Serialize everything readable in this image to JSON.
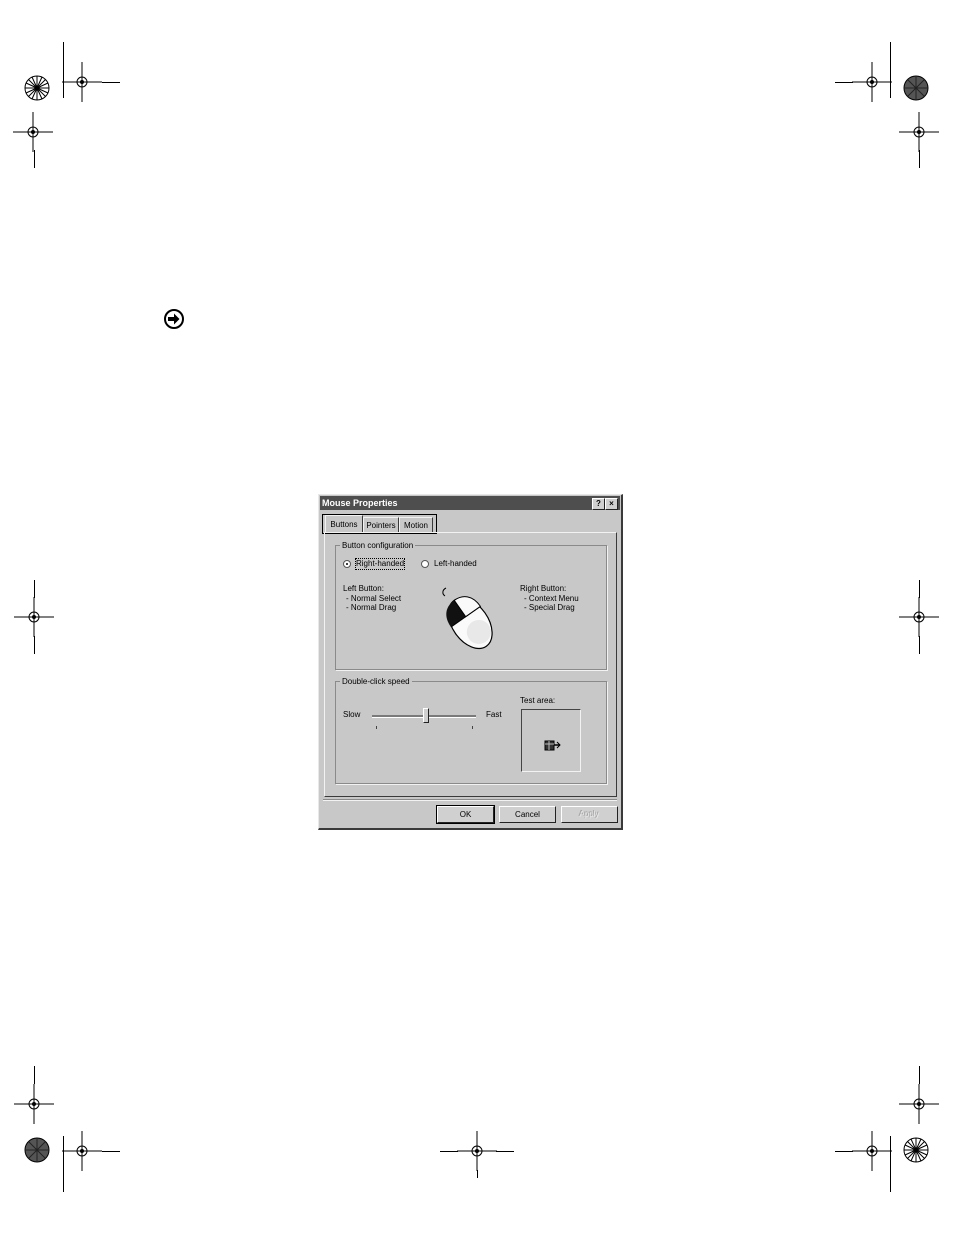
{
  "dialog": {
    "title": "Mouse Properties",
    "help_glyph": "?",
    "close_glyph": "×",
    "tabs": [
      {
        "label": "Buttons",
        "selected": true
      },
      {
        "label": "Pointers",
        "selected": false
      },
      {
        "label": "Motion",
        "selected": false
      }
    ],
    "button_config": {
      "group_label": "Button configuration",
      "right_handed_label": "Right-handed",
      "left_handed_label": "Left-handed",
      "selected": "Right-handed",
      "left_button_heading": "Left Button:",
      "left_button_lines": [
        "- Normal Select",
        "- Normal Drag"
      ],
      "right_button_heading": "Right Button:",
      "right_button_lines": [
        "- Context Menu",
        "- Special Drag"
      ]
    },
    "double_click": {
      "group_label": "Double-click speed",
      "slow_label": "Slow",
      "fast_label": "Fast",
      "test_area_label": "Test area:",
      "speed_level": 0.5
    },
    "buttons": {
      "ok": "OK",
      "cancel": "Cancel",
      "apply": "Apply"
    }
  },
  "icons": {
    "registration_mark": "crosshair-circle-icon",
    "starburst": "starburst-icon",
    "arrow": "right-arrow-icon",
    "mouse": "mouse-icon",
    "jack_in_the_box": "jack-in-the-box-icon"
  }
}
